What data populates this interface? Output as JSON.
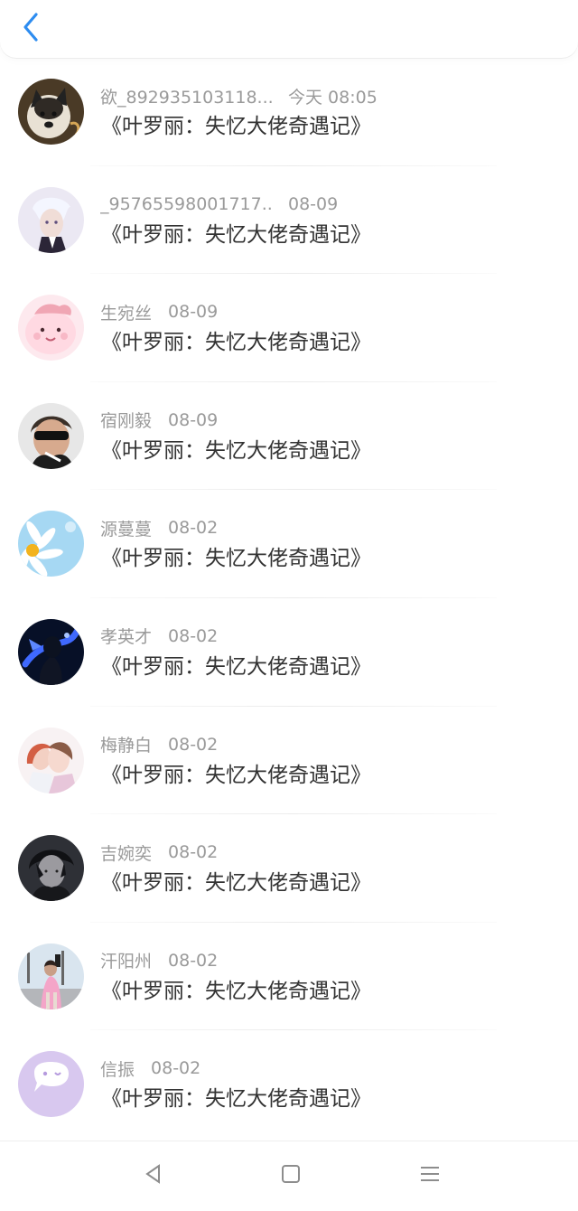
{
  "header": {
    "back_icon": "chevron-left-icon",
    "accent": "#2d8cf0"
  },
  "items": [
    {
      "name": "欲_892935103118...",
      "time": "今天 08:05",
      "title": "《叶罗丽：失忆大佬奇遇记》",
      "avatar": "dog-photo"
    },
    {
      "name": "_95765598001717...",
      "time": "08-09",
      "title": "《叶罗丽：失忆大佬奇遇记》",
      "avatar": "anime-boy-white-hair"
    },
    {
      "name": "生宛丝",
      "time": "08-09",
      "title": "《叶罗丽：失忆大佬奇遇记》",
      "avatar": "pink-cartoon"
    },
    {
      "name": "宿刚毅",
      "time": "08-09",
      "title": "《叶罗丽：失忆大佬奇遇记》",
      "avatar": "man-sunglasses"
    },
    {
      "name": "源蔓蔓",
      "time": "08-02",
      "title": "《叶罗丽：失忆大佬奇遇记》",
      "avatar": "daisy-sky"
    },
    {
      "name": "孝英才",
      "time": "08-02",
      "title": "《叶罗丽：失忆大佬奇遇记》",
      "avatar": "blue-night-silhouette"
    },
    {
      "name": "梅静白",
      "time": "08-02",
      "title": "《叶罗丽：失忆大佬奇遇记》",
      "avatar": "anime-couple"
    },
    {
      "name": "吉婉奕",
      "time": "08-02",
      "title": "《叶罗丽：失忆大佬奇遇记》",
      "avatar": "anime-dark-boy"
    },
    {
      "name": "汗阳州",
      "time": "08-02",
      "title": "《叶罗丽：失忆大佬奇遇记》",
      "avatar": "girl-street"
    },
    {
      "name": "信振",
      "time": "08-02",
      "title": "《叶罗丽：失忆大佬奇遇记》",
      "avatar": "chat-bubble-purple"
    }
  ],
  "navbar": {
    "back": "triangle-back-icon",
    "home": "square-home-icon",
    "menu": "menu-lines-icon"
  }
}
